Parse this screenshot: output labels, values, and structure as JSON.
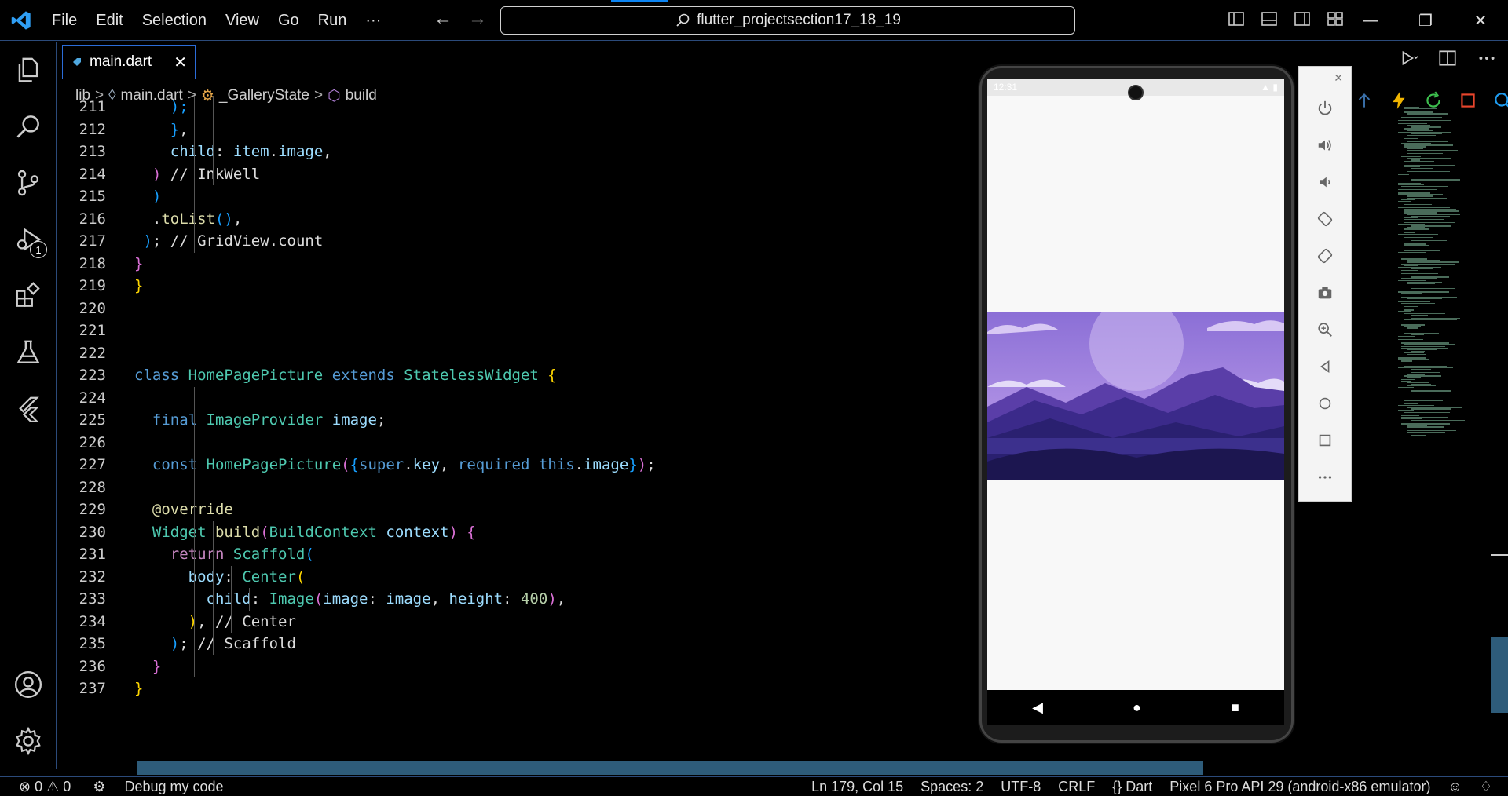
{
  "menu": [
    "File",
    "Edit",
    "Selection",
    "View",
    "Go",
    "Run",
    "···"
  ],
  "search": {
    "text": "flutter_projectsection17_18_19"
  },
  "tab": {
    "label": "main.dart",
    "close": "✕"
  },
  "breadcrumb": [
    "lib",
    "main.dart",
    "_GalleryState",
    "build"
  ],
  "code_lines": [
    {
      "n": "211",
      "html": "<span class='b3'>    );</span>"
    },
    {
      "n": "212",
      "html": "    <span class='b3'>}</span>,"
    },
    {
      "n": "213",
      "html": "    <span class='var'>child</span>: <span class='var'>item</span>.<span class='var'>image</span>,"
    },
    {
      "n": "214",
      "html": "  <span class='b2'>)</span> <span class='cm'>// InkWell</span>"
    },
    {
      "n": "215",
      "html": "  <span class='b3'>)</span>"
    },
    {
      "n": "216",
      "html": "  .<span class='fn'>toList</span><span class='b3'>()</span>,"
    },
    {
      "n": "217",
      "html": " <span class='b3'>)</span>; <span class='cm'>// GridView.count</span>"
    },
    {
      "n": "218",
      "html": "<span class='b2'>}</span>"
    },
    {
      "n": "219",
      "html": "<span class='b1'>}</span>"
    },
    {
      "n": "220",
      "html": ""
    },
    {
      "n": "221",
      "html": ""
    },
    {
      "n": "222",
      "html": ""
    },
    {
      "n": "223",
      "html": "<span class='kw'>class</span> <span class='ty'>HomePagePicture</span> <span class='kw'>extends</span> <span class='ty'>StatelessWidget</span> <span class='b1'>{</span>"
    },
    {
      "n": "224",
      "html": ""
    },
    {
      "n": "225",
      "html": "  <span class='kw'>final</span> <span class='ty'>ImageProvider</span> <span class='var'>image</span>;"
    },
    {
      "n": "226",
      "html": ""
    },
    {
      "n": "227",
      "html": "  <span class='kw'>const</span> <span class='ty'>HomePagePicture</span><span class='b2'>(</span><span class='b3'>{</span><span class='kw'>super</span>.<span class='var'>key</span>, <span class='kw'>required</span> <span class='kw'>this</span>.<span class='var'>image</span><span class='b3'>}</span><span class='b2'>)</span>;"
    },
    {
      "n": "228",
      "html": ""
    },
    {
      "n": "229",
      "html": "  <span class='ann'>@override</span>"
    },
    {
      "n": "230",
      "html": "  <span class='ty'>Widget</span> <span class='fn'>build</span><span class='b2'>(</span><span class='ty'>BuildContext</span> <span class='var'>context</span><span class='b2'>)</span> <span class='b2'>{</span>"
    },
    {
      "n": "231",
      "html": "    <span class='ctrl'>return</span> <span class='ty'>Scaffold</span><span class='b3'>(</span>"
    },
    {
      "n": "232",
      "html": "      <span class='var'>body</span>: <span class='ty'>Center</span><span class='b1'>(</span>"
    },
    {
      "n": "233",
      "html": "        <span class='var'>child</span>: <span class='ty'>Image</span><span class='b2'>(</span><span class='var'>image</span>: <span class='var'>image</span>, <span class='var'>height</span>: <span class='num'>400</span><span class='b2'>)</span>,"
    },
    {
      "n": "234",
      "html": "      <span class='b1'>)</span>, <span class='cm'>// Center</span>"
    },
    {
      "n": "235",
      "html": "    <span class='b3'>)</span>; <span class='cm'>// Scaffold</span>"
    },
    {
      "n": "236",
      "html": "  <span class='b2'>}</span>"
    },
    {
      "n": "237",
      "html": "<span class='b1'>}</span>"
    }
  ],
  "debug_badge": "1",
  "emulator": {
    "time": "12:31"
  },
  "status": {
    "errors": "0",
    "warnings": "0",
    "debug": "Debug my code",
    "position": "Ln 179, Col 15",
    "spaces": "Spaces: 2",
    "encoding": "UTF-8",
    "eol": "CRLF",
    "language": "Dart",
    "device": "Pixel 6 Pro API 29 (android-x86 emulator)"
  }
}
